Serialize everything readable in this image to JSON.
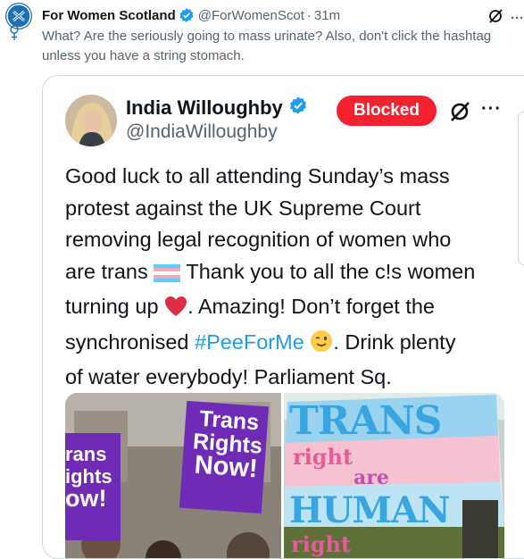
{
  "post": {
    "author_name": "For Women Scotland",
    "author_handle": "@ForWomenScot",
    "separator": "·",
    "time": "31m",
    "text": "What? Are the seriously going to mass urinate? Also, don't click the hashtag unless you have a string stomach.",
    "more_label": "···"
  },
  "quote": {
    "author_name": "India Willoughby",
    "author_handle": "@IndiaWilloughby",
    "blocked_label": "Blocked",
    "more_label": "···",
    "body_line1": "Good luck to all attending Sunday’s mass",
    "body_line2": "protest against the UK Supreme Court",
    "body_line3": "removing legal recognition of women who",
    "body_line4a": "are trans ",
    "body_line4b": " Thank you to all the c!s women",
    "body_line5a": "turning up ",
    "body_line5b": ". Amazing! Don’t forget the",
    "body_line6a": "synchronised ",
    "hashtag": "#PeeForMe",
    "body_line6b": ". Drink plenty",
    "body_line7": "of water everybody! Parliament Sq."
  },
  "media": {
    "left_sign_main": [
      "Trans",
      "Rights",
      "Now!"
    ],
    "left_sign_side": [
      "rans",
      "ights",
      "ow!"
    ],
    "right_sign_words": [
      "TRANS",
      "right",
      "are",
      "HUMAN",
      "right"
    ]
  },
  "colors": {
    "accent": "#1d9bf0",
    "blocked": "#f4212e",
    "verified": "#1d9bf0",
    "muted_text": "#536471"
  }
}
